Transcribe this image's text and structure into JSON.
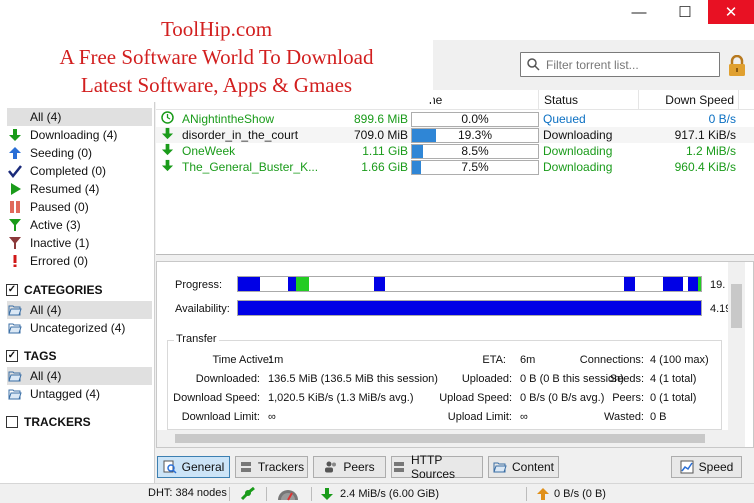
{
  "watermark": {
    "line1": "ToolHip.com",
    "line2": "A Free Software World To Download",
    "line3": "Latest Software, Apps & Gmaes"
  },
  "window": {
    "minimize": "—",
    "maximize": "☐",
    "close": "✕"
  },
  "search": {
    "placeholder": "Filter torrent list..."
  },
  "sidebar": {
    "status_items": [
      {
        "label": "All (4)",
        "icon": "filter-all-icon"
      },
      {
        "label": "Downloading (4)",
        "icon": "arrow-down-icon"
      },
      {
        "label": "Seeding (0)",
        "icon": "arrow-up-icon"
      },
      {
        "label": "Completed (0)",
        "icon": "checkmark-icon"
      },
      {
        "label": "Resumed (4)",
        "icon": "play-icon"
      },
      {
        "label": "Paused (0)",
        "icon": "pause-icon"
      },
      {
        "label": "Active (3)",
        "icon": "funnel-green-icon"
      },
      {
        "label": "Inactive (1)",
        "icon": "funnel-red-icon"
      },
      {
        "label": "Errored (0)",
        "icon": "exclamation-icon"
      }
    ],
    "categories_header": "CATEGORIES",
    "categories": [
      {
        "label": "All (4)"
      },
      {
        "label": "Uncategorized (4)"
      }
    ],
    "tags_header": "TAGS",
    "tags": [
      {
        "label": "All (4)"
      },
      {
        "label": "Untagged (4)"
      }
    ],
    "trackers_header": "TRACKERS"
  },
  "table": {
    "headers": {
      "name": "ne",
      "status": "Status",
      "down_speed": "Down Speed"
    },
    "rows": [
      {
        "name": "ANightintheShow",
        "size": "899.6 MiB",
        "progress_text": "0.0%",
        "progress": 0.0,
        "status": "Queued",
        "speed": "0 B/s"
      },
      {
        "name": "disorder_in_the_court",
        "size": "709.0 MiB",
        "progress_text": "19.3%",
        "progress": 0.193,
        "status": "Downloading",
        "speed": "917.1 KiB/s"
      },
      {
        "name": "OneWeek",
        "size": "1.11 GiB",
        "progress_text": "8.5%",
        "progress": 0.085,
        "status": "Downloading",
        "speed": "1.2 MiB/s"
      },
      {
        "name": "The_General_Buster_K...",
        "size": "1.66 GiB",
        "progress_text": "7.5%",
        "progress": 0.075,
        "status": "Downloading",
        "speed": "960.4 KiB/s"
      }
    ]
  },
  "details": {
    "progress_label": "Progress:",
    "progress_value": "19.",
    "availability_label": "Availability:",
    "availability_value": "4.19",
    "transfer_title": "Transfer",
    "fields": {
      "time_active_label": "Time Active:",
      "time_active": "1m",
      "eta_label": "ETA:",
      "eta": "6m",
      "connections_label": "Connections:",
      "connections": "4 (100 max)",
      "downloaded_label": "Downloaded:",
      "downloaded": "136.5 MiB (136.5 MiB this session)",
      "uploaded_label": "Uploaded:",
      "uploaded": "0 B (0 B this session)",
      "seeds_label": "Seeds:",
      "seeds": "4 (1 total)",
      "dl_speed_label": "Download Speed:",
      "dl_speed": "1,020.5 KiB/s (1.3 MiB/s avg.)",
      "ul_speed_label": "Upload Speed:",
      "ul_speed": "0 B/s (0 B/s avg.)",
      "peers_label": "Peers:",
      "peers": "0 (1 total)",
      "dl_limit_label": "Download Limit:",
      "dl_limit": "∞",
      "ul_limit_label": "Upload Limit:",
      "ul_limit": "∞",
      "wasted_label": "Wasted:",
      "wasted": "0 B"
    }
  },
  "tabs": {
    "general": "General",
    "trackers": "Trackers",
    "peers": "Peers",
    "http_sources": "HTTP Sources",
    "content": "Content",
    "speed": "Speed"
  },
  "statusbar": {
    "dht": "DHT: 384 nodes",
    "download": "2.4 MiB/s (6.00 GiB)",
    "upload": "0 B/s (0 B)"
  },
  "colors": {
    "accent": "#2f86d6",
    "downloading": "#1a9b1a",
    "queued": "#0a6fc2",
    "piece": "#0000e6",
    "piece_complete": "#22cc22",
    "close": "#e81123"
  }
}
